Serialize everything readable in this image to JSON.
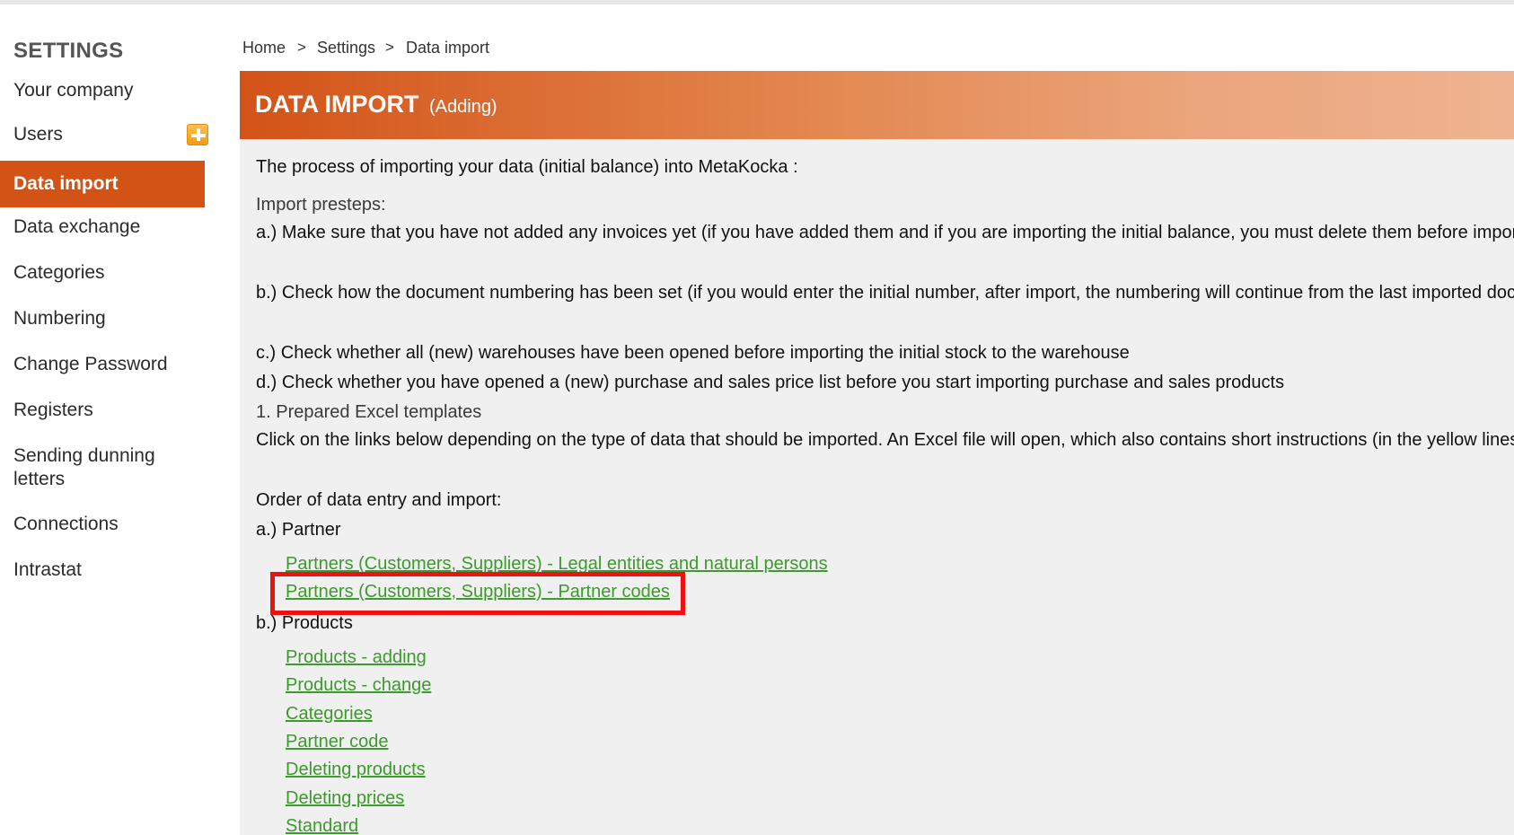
{
  "sidebar": {
    "title": "SETTINGS",
    "items": [
      {
        "label": "Your company"
      },
      {
        "label": "Users"
      },
      {
        "label": "Data import"
      },
      {
        "label": "Data exchange"
      },
      {
        "label": "Categories"
      },
      {
        "label": "Numbering"
      },
      {
        "label": "Change Password"
      },
      {
        "label": "Registers"
      },
      {
        "label": "Sending dunning letters"
      },
      {
        "label": "Connections"
      },
      {
        "label": "Intrastat"
      }
    ],
    "users_add_icon": "plus-square-icon",
    "active_color": "#d35317"
  },
  "breadcrumb": {
    "home": "Home",
    "settings": "Settings",
    "current": "Data import",
    "separator": ">"
  },
  "header": {
    "title": "DATA IMPORT",
    "subtitle": "(Adding)"
  },
  "content": {
    "intro": "The process of importing your data (initial balance) into MetaKocka :",
    "presteps_heading": "Import presteps:",
    "step_a": "a.) Make sure that you have not added any invoices yet (if you have added them and if you are importing the initial balance, you must delete them before impor",
    "step_b": "b.) Check how the document numbering has been set (if you would enter the initial number, after import, the numbering will continue from the last imported doc",
    "step_c": "c.) Check whether all (new) warehouses have been opened before importing the initial stock to the warehouse",
    "step_d": "d.) Check whether you have opened a (new) purchase and sales price list before you start importing purchase and sales products",
    "templates_heading": "1. Prepared Excel templates",
    "templates_text": "Click on the links below depending on the type of data that should be imported. An Excel file will open, which also contains short instructions (in the yellow lines",
    "order_heading": "Order of data entry and import:",
    "partner_heading": "a.) Partner",
    "partner_links": [
      "Partners (Customers, Suppliers) - Legal entities and natural persons",
      "Partners (Customers, Suppliers) - Partner codes"
    ],
    "products_heading": "b.) Products",
    "product_links": [
      "Products - adding",
      "Products - change",
      "Categories",
      "Partner code",
      "Deleting products",
      "Deleting prices",
      "Standard"
    ]
  },
  "colors": {
    "link": "#3d9a2c",
    "highlight": "#ee1111",
    "banner_start": "#d35317"
  }
}
